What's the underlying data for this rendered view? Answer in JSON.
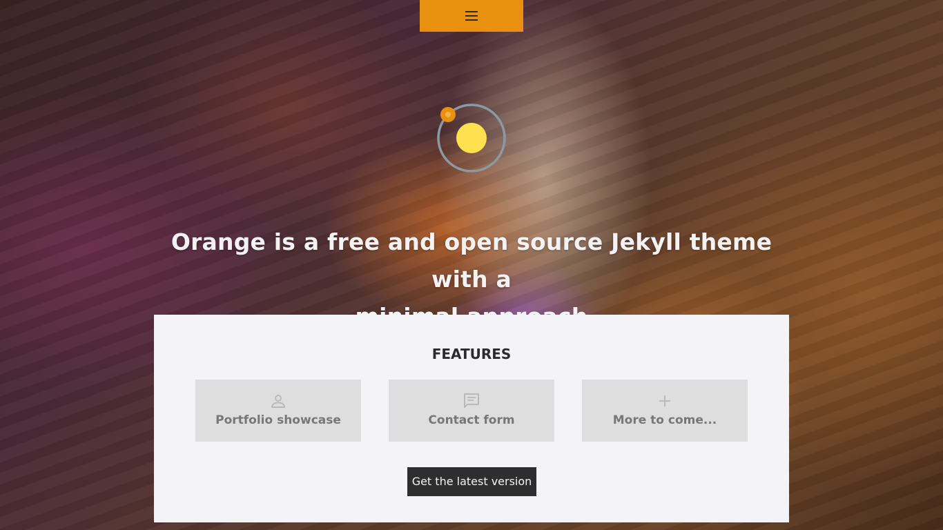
{
  "header": {
    "menu_icon": "hamburger-menu-icon"
  },
  "logo": {
    "icon": "orbit-logo-icon"
  },
  "hero": {
    "headline_line1": "Orange is a free and open source Jekyll theme with a",
    "headline_line2": "minimal approach"
  },
  "features": {
    "heading": "FEATURES",
    "items": [
      {
        "label": "Portfolio showcase",
        "icon": "person-icon"
      },
      {
        "label": "Contact form",
        "icon": "chat-bubble-icon"
      },
      {
        "label": "More to come...",
        "icon": "plus-icon"
      }
    ],
    "cta_label": "Get the latest version"
  },
  "colors": {
    "accent": "#e8900f",
    "sun": "#ffe04f",
    "ring": "#8a9aa4",
    "panel": "#f4f3f8",
    "card": "#dedede",
    "button": "#2e2e2e"
  }
}
